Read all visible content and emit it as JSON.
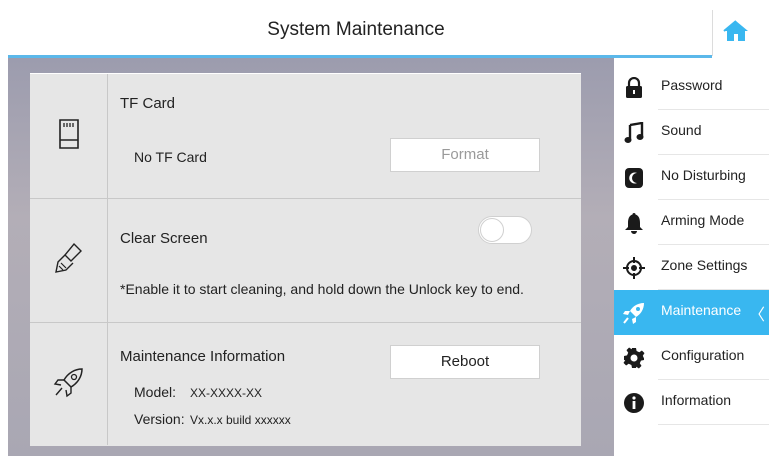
{
  "header": {
    "title": "System Maintenance"
  },
  "panel": {
    "tf_card": {
      "title": "TF Card",
      "status": "No TF Card",
      "format_label": "Format"
    },
    "clear_screen": {
      "title": "Clear Screen",
      "note": "*Enable it to start cleaning, and hold down the Unlock key to end.",
      "toggle_on": false
    },
    "maintenance_info": {
      "title": "Maintenance Information",
      "reboot_label": "Reboot",
      "model_label": "Model:",
      "model_value": "XX-XXXX-XX",
      "version_label": "Version:",
      "version_value": "Vx.x.x build xxxxxx"
    }
  },
  "sidebar": {
    "items": [
      {
        "label": "Password",
        "icon": "lock-icon"
      },
      {
        "label": "Sound",
        "icon": "music-note-icon"
      },
      {
        "label": "No Disturbing",
        "icon": "no-disturb-icon"
      },
      {
        "label": "Arming Mode",
        "icon": "bell-icon"
      },
      {
        "label": "Zone Settings",
        "icon": "crosshair-icon"
      },
      {
        "label": "Maintenance",
        "icon": "rocket-icon",
        "active": true,
        "chevron": "〈"
      },
      {
        "label": "Configuration",
        "icon": "gear-icon"
      },
      {
        "label": "Information",
        "icon": "info-icon"
      }
    ]
  },
  "colors": {
    "accent": "#39b7f0",
    "header_line": "#5bb8ea"
  }
}
